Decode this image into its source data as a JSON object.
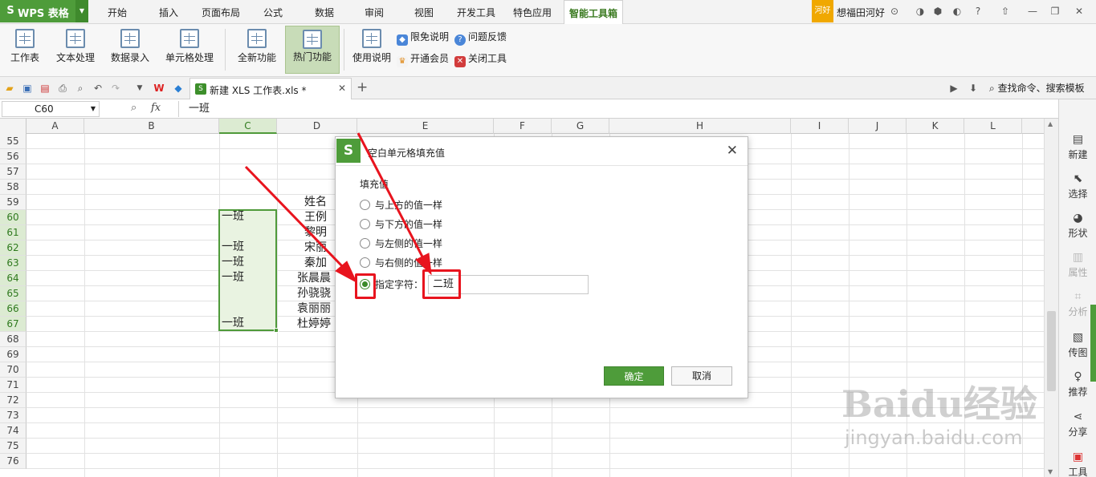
{
  "app": {
    "name": "WPS 表格",
    "logo": "S"
  },
  "menu": [
    "开始",
    "插入",
    "页面布局",
    "公式",
    "数据",
    "审阅",
    "视图",
    "开发工具",
    "特色应用",
    "智能工具箱"
  ],
  "account": {
    "badge": "河好",
    "user": "想福田河好"
  },
  "ribbon": {
    "large": [
      "工作表",
      "文本处理",
      "数据录入",
      "单元格处理",
      "全新功能",
      "热门功能",
      "使用说明"
    ],
    "small": [
      "限免说明",
      "问题反馈",
      "开通会员",
      "关闭工具"
    ]
  },
  "doc_tab": {
    "title": "新建 XLS 工作表.xls *"
  },
  "search_cmd": "查找命令、搜索模板",
  "formula_bar": {
    "cell": "C60",
    "fx": "fx",
    "value": "一班"
  },
  "columns": [
    "A",
    "B",
    "C",
    "D",
    "E",
    "F",
    "G",
    "H",
    "I",
    "J",
    "K",
    "L"
  ],
  "rows": [
    "55",
    "56",
    "57",
    "58",
    "59",
    "60",
    "61",
    "62",
    "63",
    "64",
    "65",
    "66",
    "67",
    "68",
    "69",
    "70",
    "71",
    "72",
    "73",
    "74",
    "75",
    "76"
  ],
  "cells_c": {
    "r60": "一班",
    "r62": "一班",
    "r63": "一班",
    "r64": "一班",
    "r67": "一班"
  },
  "cells_d": {
    "r59": "姓名",
    "r60": "王例",
    "r61": "黎明",
    "r62": "宋丽",
    "r63": "秦加",
    "r64": "张晨晨",
    "r65": "孙骁骁",
    "r66": "袁丽丽",
    "r67": "杜婷婷"
  },
  "right_panel": [
    "新建",
    "选择",
    "形状",
    "属性",
    "分析",
    "传图",
    "推荐",
    "分享",
    "工具"
  ],
  "dialog": {
    "title": "空白单元格填充值",
    "group": "填充值",
    "options": [
      "与上方的值一样",
      "与下方的值一样",
      "与左侧的值一样",
      "与右侧的值一样"
    ],
    "specify_label": "指定字符：",
    "specify_value": "二班",
    "ok": "确定",
    "cancel": "取消",
    "selected": 4
  },
  "watermark": {
    "text": "Baidu经验",
    "url": "jingyan.baidu.com"
  },
  "colors": {
    "accent": "#4e9c3a",
    "annotation": "#e8141e",
    "selection": "#e9f3e1"
  }
}
